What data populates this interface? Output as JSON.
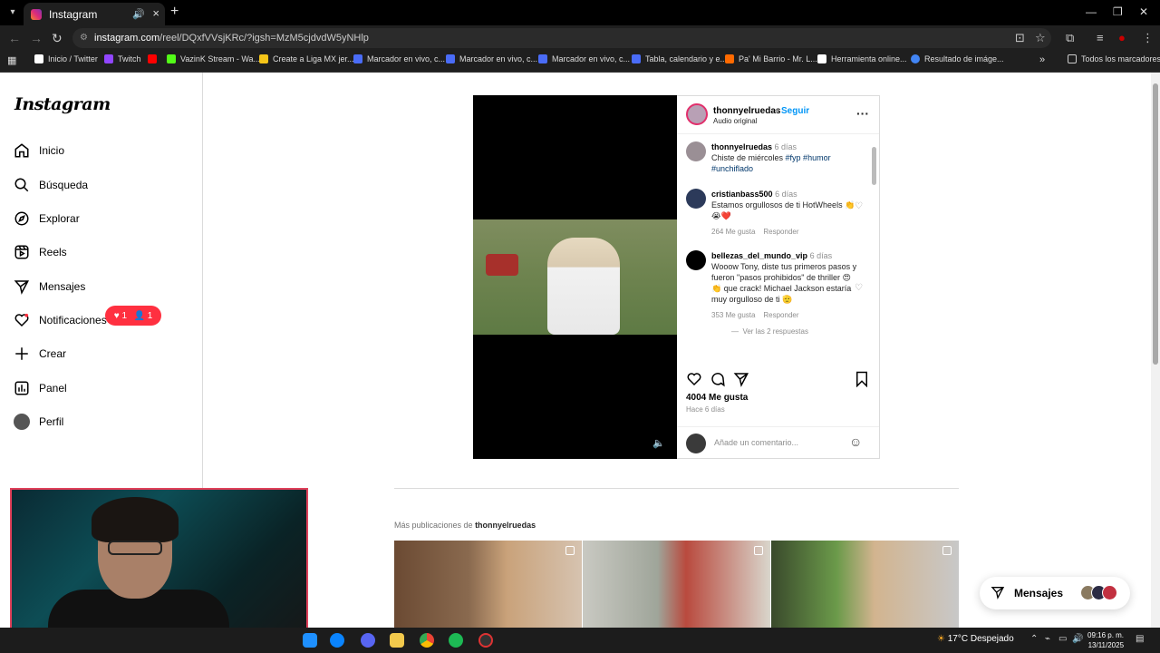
{
  "browser": {
    "tab_title": "Instagram",
    "url_host": "instagram.com",
    "url_path": "/reel/DQxfVVsjKRc/?igsh=MzM5cjdvdW5yNHlp",
    "bookmarks": [
      {
        "label": "Inicio / Twitter",
        "color": "#ffffff"
      },
      {
        "label": "Twitch",
        "color": "#9146ff"
      },
      {
        "label": "",
        "color": "#ff0000"
      },
      {
        "label": "VazinK Stream - Wa...",
        "color": "#53fc18"
      },
      {
        "label": "Create a Liga MX jer...",
        "color": "#f5c518"
      },
      {
        "label": "Marcador en vivo, c...",
        "color": "#4a6cf7"
      },
      {
        "label": "Marcador en vivo, c...",
        "color": "#4a6cf7"
      },
      {
        "label": "Marcador en vivo, c...",
        "color": "#4a6cf7"
      },
      {
        "label": "Tabla, calendario y e...",
        "color": "#4a6cf7"
      },
      {
        "label": "Pa' Mi Barrio - Mr. L...",
        "color": "#ff6a00"
      },
      {
        "label": "Herramienta online...",
        "color": "#ffffff"
      },
      {
        "label": "Resultado de imáge...",
        "color": "#4285f4"
      }
    ],
    "all_bookmarks": "Todos los marcadores"
  },
  "sidebar": {
    "logo": "Instagram",
    "items": [
      {
        "label": "Inicio",
        "icon": "home-icon"
      },
      {
        "label": "Búsqueda",
        "icon": "search-icon"
      },
      {
        "label": "Explorar",
        "icon": "compass-icon"
      },
      {
        "label": "Reels",
        "icon": "reels-icon"
      },
      {
        "label": "Mensajes",
        "icon": "send-icon"
      },
      {
        "label": "Notificaciones",
        "icon": "heart-icon"
      },
      {
        "label": "Crear",
        "icon": "plus-icon"
      },
      {
        "label": "Panel",
        "icon": "chart-icon"
      },
      {
        "label": "Perfil",
        "icon": "avatar"
      }
    ],
    "notif_likes": "1",
    "notif_follows": "1"
  },
  "post": {
    "username": "thonnyelruedas",
    "dot": "•",
    "follow": "Seguir",
    "audio": "Audio original",
    "caption": {
      "user": "thonnyelruedas",
      "time": "6 días",
      "text": "Chiste de miércoles ",
      "tags": "#fyp #humor #unchiflado"
    },
    "comments": [
      {
        "user": "cristianbass500",
        "time": "6 días",
        "text": "Estamos orgullosos de ti HotWheels 👏😭❤️",
        "likes": "264 Me gusta",
        "reply": "Responder"
      },
      {
        "user": "bellezas_del_mundo_vip",
        "time": "6 días",
        "text": "Wooow Tony, diste tus primeros pasos y fueron \"pasos prohibidos\" de thriller 😍👏 que crack! Michael Jackson estaría muy orgulloso de ti 🫡",
        "likes": "353 Me gusta",
        "reply": "Responder",
        "view_replies": "Ver las 2 respuestas"
      }
    ],
    "likes": "4004 Me gusta",
    "ago": "Hace 6 días",
    "add_comment": "Añade un comentario..."
  },
  "more": {
    "prefix": "Más publicaciones de ",
    "user": "thonnyelruedas"
  },
  "messages_pill": "Mensajes",
  "taskbar": {
    "weather": "17°C  Despejado",
    "time": "09:16 p. m.",
    "date": "13/11/2025"
  }
}
